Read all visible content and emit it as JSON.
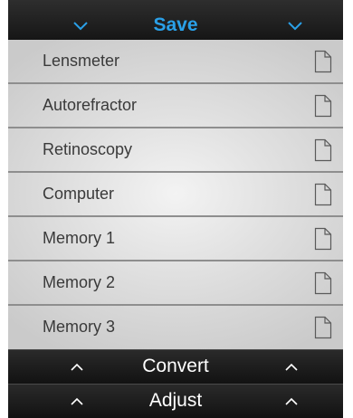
{
  "header": {
    "title": "Save",
    "title_color": "#2aa0e8",
    "left_icon": "chevron-down-icon",
    "right_icon": "chevron-down-icon"
  },
  "items": [
    {
      "label": "Lensmeter",
      "icon": "document-icon"
    },
    {
      "label": "Autorefractor",
      "icon": "document-icon"
    },
    {
      "label": "Retinoscopy",
      "icon": "document-icon"
    },
    {
      "label": "Computer",
      "icon": "document-icon"
    },
    {
      "label": "Memory 1",
      "icon": "document-icon"
    },
    {
      "label": "Memory 2",
      "icon": "document-icon"
    },
    {
      "label": "Memory 3",
      "icon": "document-icon"
    }
  ],
  "bottom_bars": [
    {
      "label": "Convert",
      "icon": "chevron-up-icon"
    },
    {
      "label": "Adjust",
      "icon": "chevron-up-icon"
    }
  ]
}
